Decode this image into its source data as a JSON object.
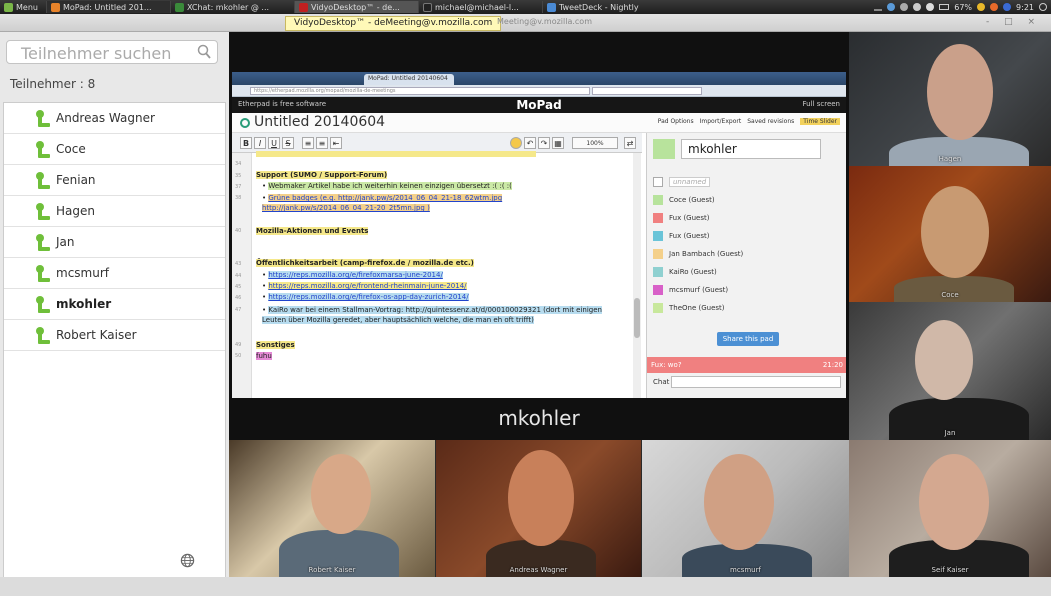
{
  "taskbar": {
    "menu_label": "Menu",
    "tasks": [
      {
        "label": "MoPad: Untitled 201...",
        "color": "#e8832a"
      },
      {
        "label": "XChat: mkohler @ ...",
        "color": "#3a8a3a"
      },
      {
        "label": "VidyoDesktop™ - de...",
        "color": "#c02020"
      },
      {
        "label": "michael@michael-l...",
        "color": "#222222"
      },
      {
        "label": "TweetDeck - Nightly",
        "color": "#4a8ad4"
      }
    ],
    "battery": "67%",
    "clock": "9:21"
  },
  "window": {
    "title": "VidyoDesktop™ - deMeeting@v.mozilla.com",
    "title_echo": "Meeting@v.mozilla.com"
  },
  "sidebar": {
    "search_placeholder": "Teilnehmer suchen",
    "participant_count": "Teilnehmer : 8",
    "participants": [
      {
        "name": "Andreas Wagner"
      },
      {
        "name": "Coce"
      },
      {
        "name": "Fenian"
      },
      {
        "name": "Hagen"
      },
      {
        "name": "Jan"
      },
      {
        "name": "mcsmurf"
      },
      {
        "name": "mkohler"
      },
      {
        "name": "Robert Kaiser"
      }
    ],
    "selected": "mkohler"
  },
  "stage": {
    "speaker_name": "mkohler"
  },
  "browser": {
    "tab_label": "MoPad: Untitled 20140604",
    "url": "https://etherpad.mozilla.org/mopad/mozilla-de-meetings",
    "header_left": "Etherpad is free software",
    "header_center": "MoPad",
    "header_right": "Full screen",
    "pad_title": "Untitled 20140604",
    "pad_actions": [
      "Pad Options",
      "Import/Export",
      "Saved revisions",
      "Time Slider"
    ],
    "zoom": "100%"
  },
  "editor": {
    "lines": [
      {
        "n": "34",
        "text": ""
      },
      {
        "n": "35",
        "text": "Support (SUMO / Support-Forum)"
      },
      {
        "n": "37",
        "text": "Webmaker Artikel habe ich weiterhin keinen einzigen übersetzt :( :( :("
      },
      {
        "n": "38",
        "text": "Grüne badges (e.g. http://jank.pw/s/2014_06_04_21-18_62wtm.jpg http://jank.pw/s/2014_06_04_21-20_2t5mn.jpg )"
      },
      {
        "n": "40",
        "text": "Mozilla-Aktionen und Events"
      },
      {
        "n": "43",
        "text": "Öffentlichkeitsarbeit (camp-firefox.de / mozilla.de etc.)"
      },
      {
        "n": "44",
        "text": "https://reps.mozilla.org/e/firefoxmarsa-june-2014/"
      },
      {
        "n": "45",
        "text": "https://reps.mozilla.org/e/frontend-rheinmain-june-2014/"
      },
      {
        "n": "46",
        "text": "https://reps.mozilla.org/e/firefox-os-app-day-zurich-2014/"
      },
      {
        "n": "47",
        "text": "KaiRo war bei einem Stallman-Vortrag: http://quintessenz.at/d/000100029321 (dort mit einigen Leuten über Mozilla geredet, aber hauptsächlich welche, die man eh oft trifft)"
      },
      {
        "n": "49",
        "text": "Sonstiges"
      },
      {
        "n": "50",
        "text": "fuhu"
      }
    ]
  },
  "users_pane": {
    "my_name": "mkohler",
    "unnamed_placeholder": "unnamed",
    "users": [
      {
        "name": "Coce (Guest)",
        "color": "#b7e39c"
      },
      {
        "name": "Fux (Guest)",
        "color": "#f08080"
      },
      {
        "name": "Fux (Guest)",
        "color": "#6ac4d8"
      },
      {
        "name": "Jan Bambach (Guest)",
        "color": "#f4d08a"
      },
      {
        "name": "KaiRo (Guest)",
        "color": "#8fd0d0"
      },
      {
        "name": "mcsmurf (Guest)",
        "color": "#d860c8"
      },
      {
        "name": "TheOne (Guest)",
        "color": "#c8e89c"
      }
    ],
    "share_label": "Share this pad",
    "chat_message": "Fux: wo?",
    "chat_time": "21:20",
    "chat_label": "Chat"
  },
  "videos": {
    "right": [
      {
        "caption": "Hagen"
      },
      {
        "caption": "Coce"
      },
      {
        "caption": "Jan"
      },
      {
        "caption": "Seif Kaiser"
      }
    ],
    "bottom": [
      {
        "caption": "Robert Kaiser"
      },
      {
        "caption": "Andreas Wagner"
      },
      {
        "caption": "mcsmurf"
      }
    ]
  }
}
